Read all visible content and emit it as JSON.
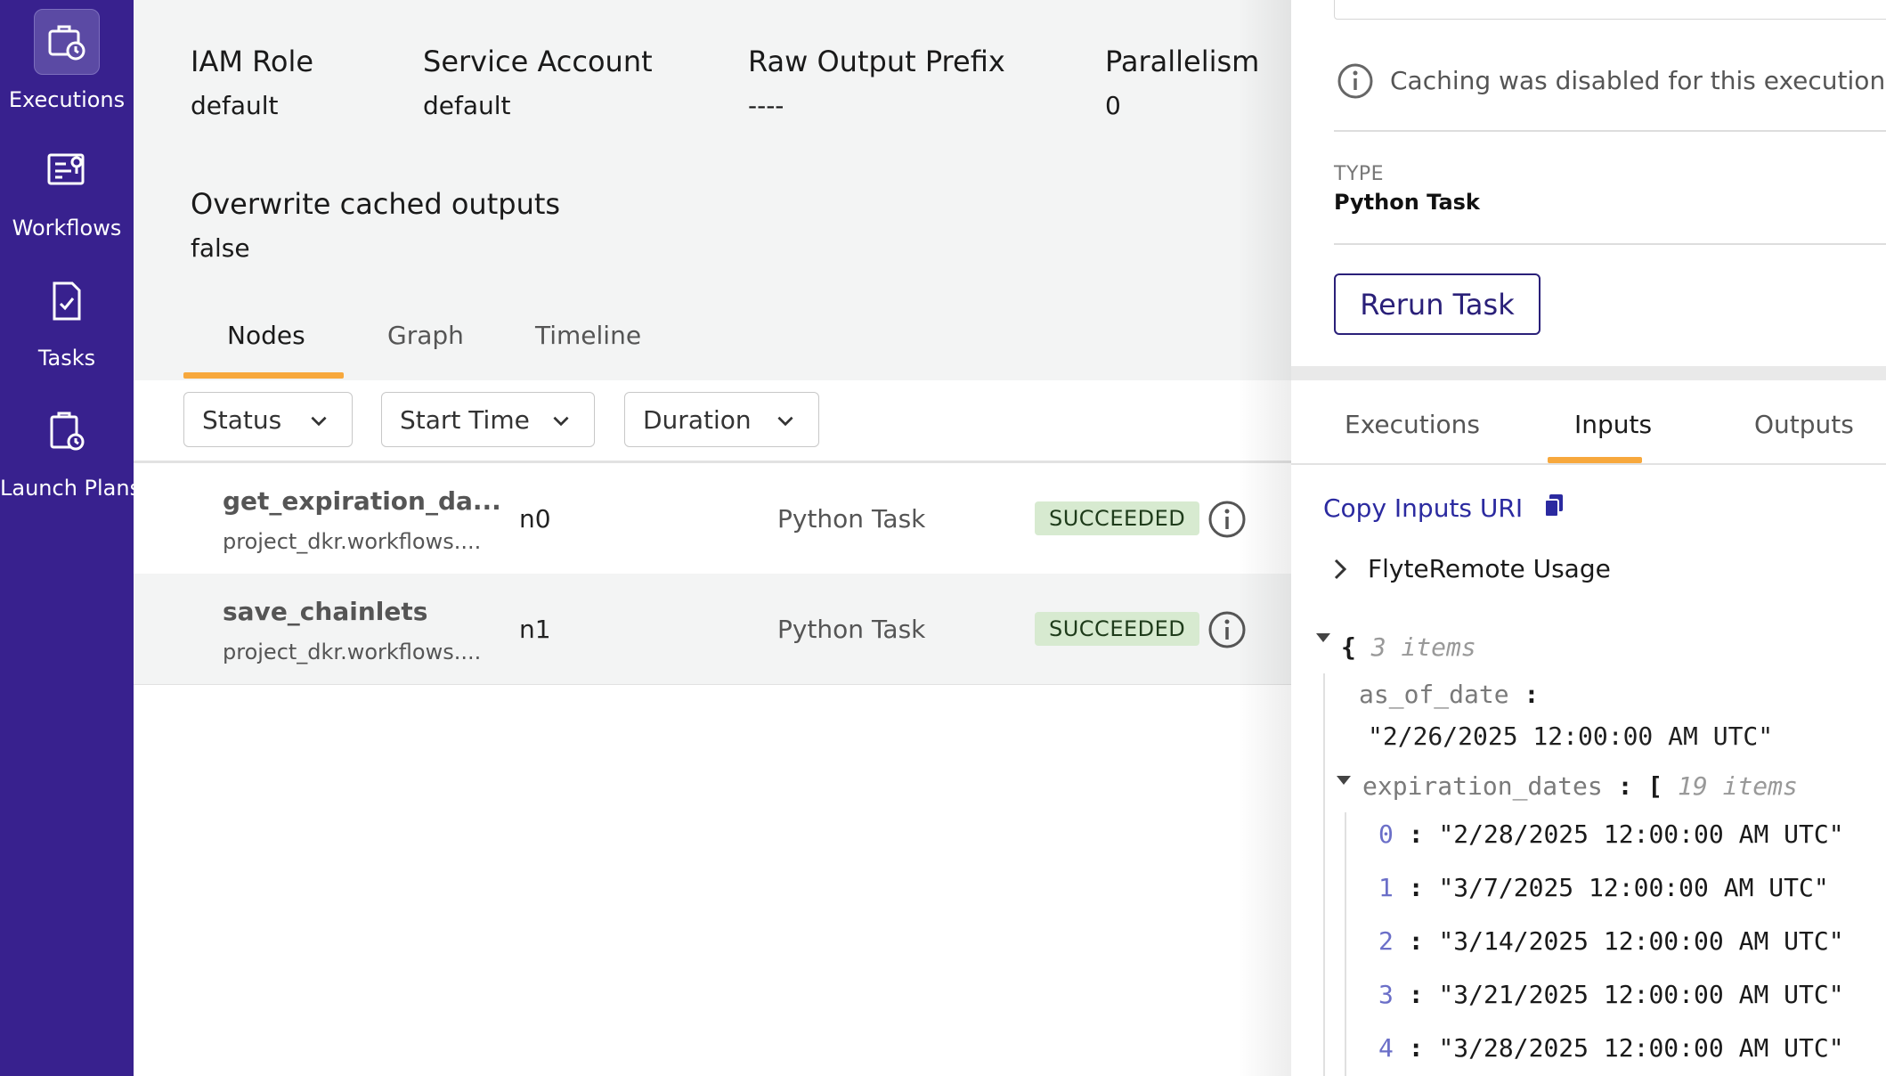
{
  "sidebar": {
    "items": [
      {
        "label": "Executions",
        "icon": "executions-icon",
        "active": true
      },
      {
        "label": "Workflows",
        "icon": "workflows-icon",
        "active": false
      },
      {
        "label": "Tasks",
        "icon": "tasks-icon",
        "active": false
      },
      {
        "label": "Launch Plans",
        "icon": "launch-plans-icon",
        "active": false
      }
    ]
  },
  "metadata": {
    "iam_role": {
      "label": "IAM Role",
      "value": "default"
    },
    "service_account": {
      "label": "Service Account",
      "value": "default"
    },
    "raw_output_prefix": {
      "label": "Raw Output Prefix",
      "value": "----"
    },
    "parallelism": {
      "label": "Parallelism",
      "value": "0"
    },
    "overwrite_cache": {
      "label": "Overwrite cached outputs",
      "value": "false"
    }
  },
  "tabs": [
    {
      "label": "Nodes",
      "active": true
    },
    {
      "label": "Graph",
      "active": false
    },
    {
      "label": "Timeline",
      "active": false
    }
  ],
  "filters": [
    {
      "label": "Status"
    },
    {
      "label": "Start Time"
    },
    {
      "label": "Duration"
    }
  ],
  "nodes": [
    {
      "name": "get_expiration_da...",
      "sub": "project_dkr.workflows....",
      "id": "n0",
      "type": "Python Task",
      "status": "SUCCEEDED"
    },
    {
      "name": "save_chainlets",
      "sub": "project_dkr.workflows....",
      "id": "n1",
      "type": "Python Task",
      "status": "SUCCEEDED"
    }
  ],
  "panel": {
    "cache_note": "Caching was disabled for this execution.",
    "type_label": "TYPE",
    "type_value": "Python Task",
    "rerun_label": "Rerun Task",
    "tabs": [
      {
        "label": "Executions",
        "active": false
      },
      {
        "label": "Inputs",
        "active": true
      },
      {
        "label": "Outputs",
        "active": false
      }
    ],
    "copy_uri_label": "Copy Inputs URI",
    "remote_usage_label": "FlyteRemote Usage",
    "inputs": {
      "root_count": "3 items",
      "as_of_date_key": "as_of_date",
      "as_of_date_value": "\"2/26/2025 12:00:00 AM UTC\"",
      "expiration_dates_key": "expiration_dates",
      "expiration_dates_count": "19 items",
      "expiration_dates": [
        {
          "idx": "0",
          "value": "\"2/28/2025 12:00:00 AM UTC\""
        },
        {
          "idx": "1",
          "value": "\"3/7/2025 12:00:00 AM UTC\""
        },
        {
          "idx": "2",
          "value": "\"3/14/2025 12:00:00 AM UTC\""
        },
        {
          "idx": "3",
          "value": "\"3/21/2025 12:00:00 AM UTC\""
        },
        {
          "idx": "4",
          "value": "\"3/28/2025 12:00:00 AM UTC\""
        }
      ]
    }
  },
  "colors": {
    "sidebar": "#38218e",
    "accent_tab": "#f7a83d",
    "success_badge": "#d7ead0",
    "link": "#2b2aa0"
  }
}
